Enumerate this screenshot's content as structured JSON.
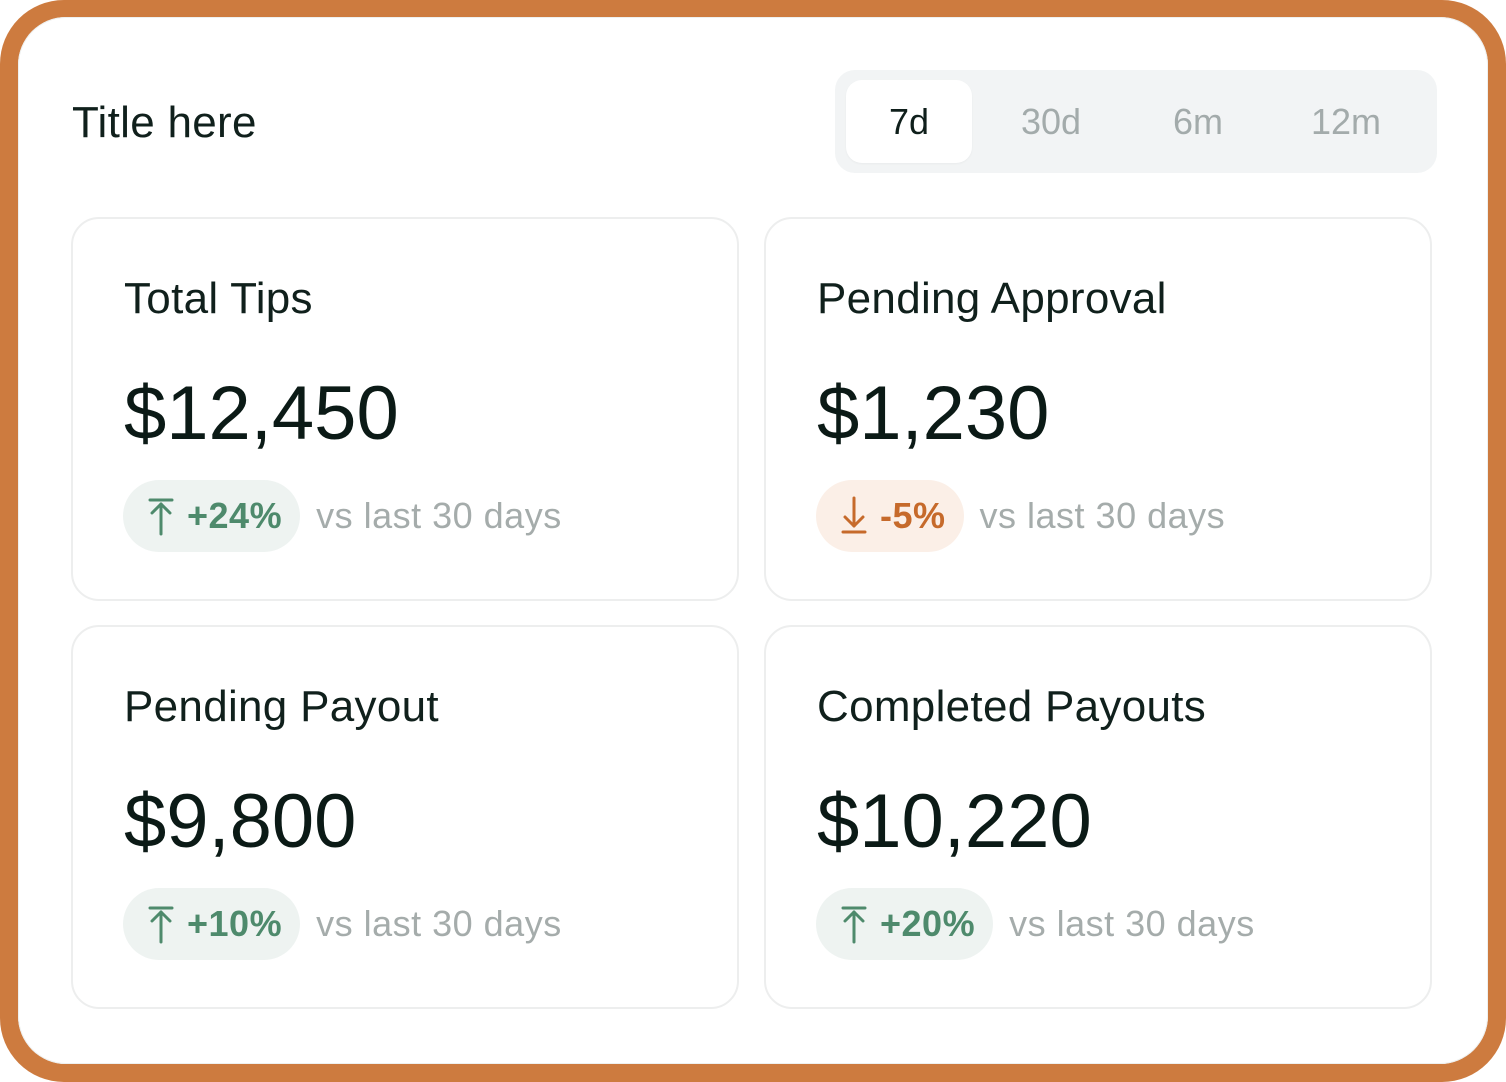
{
  "header": {
    "title": "Title here"
  },
  "range_tabs": {
    "selected": "7d",
    "tabs": [
      {
        "label": "7d"
      },
      {
        "label": "30d"
      },
      {
        "label": "6m"
      },
      {
        "label": "12m"
      }
    ]
  },
  "cards": [
    {
      "label": "Total Tips",
      "value": "$12,450",
      "delta": "+24%",
      "trend": "up",
      "compare": "vs last 30 days"
    },
    {
      "label": "Pending Approval",
      "value": "$1,230",
      "delta": "-5%",
      "trend": "down",
      "compare": "vs last 30 days"
    },
    {
      "label": "Pending Payout",
      "value": "$9,800",
      "delta": "+10%",
      "trend": "up",
      "compare": "vs last 30 days"
    },
    {
      "label": "Completed Payouts",
      "value": "$10,220",
      "delta": "+20%",
      "trend": "up",
      "compare": "vs last 30 days"
    }
  ],
  "icons": {
    "up": "arrow-up-icon",
    "down": "arrow-down-icon"
  },
  "colors": {
    "frame": "#cd7b3f",
    "up_text": "#4e8a6c",
    "up_bg": "#eef3f1",
    "down_text": "#c66a2b",
    "down_bg": "#fbefe7"
  }
}
